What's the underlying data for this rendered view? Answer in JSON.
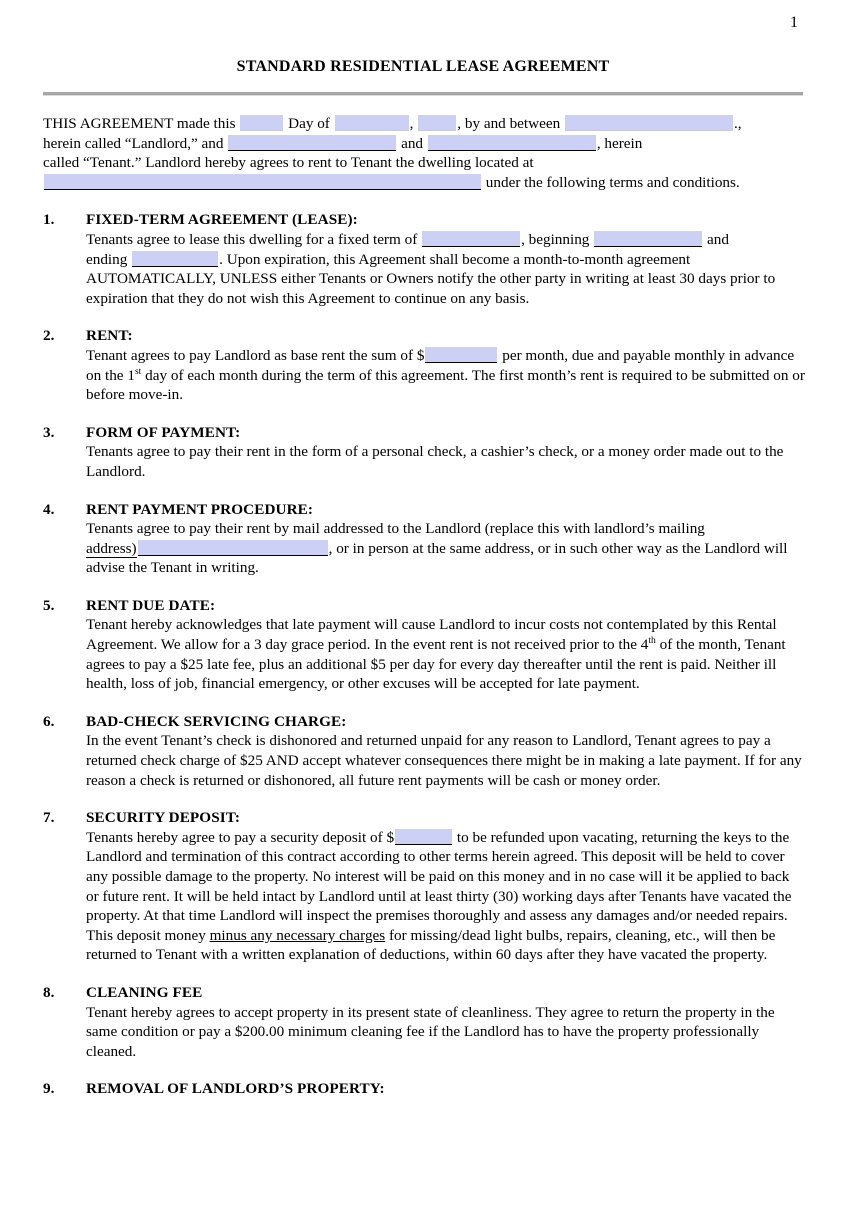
{
  "document": {
    "page_number": "1",
    "title": "STANDARD RESIDENTIAL LEASE AGREEMENT",
    "fill_field_color": "#ccd0f5",
    "rule_color": "#a6a6a6"
  },
  "intro": {
    "t1": "THIS AGREEMENT made this",
    "t2": "Day of",
    "t3": ",",
    "t4": ", by and between",
    "t5": ".,",
    "t6": "herein called “Landlord,” and",
    "t7": "and",
    "t8": ", herein",
    "t9": "called “Tenant.”  Landlord hereby agrees to rent to Tenant the dwelling located at",
    "t10": "under the following terms and conditions."
  },
  "sections": [
    {
      "number": "1.",
      "heading": "FIXED-TERM AGREEMENT (LEASE):",
      "parts": {
        "a": "Tenants agree to lease this dwelling for a fixed term of",
        "b": ", beginning",
        "c": "and",
        "d": "ending",
        "e": ".  Upon expiration, this Agreement shall become a month-to-month agreement AUTOMATICALLY, UNLESS either Tenants or Owners notify the other party in writing at least 30 days prior to expiration that they do not wish this Agreement to continue on any basis."
      }
    },
    {
      "number": "2.",
      "heading": "RENT:",
      "parts": {
        "a": "Tenant agrees to pay Landlord as base rent the sum of $",
        "b": "per month, due and payable monthly in advance on the 1",
        "sup": "st",
        "c": " day of each month during the term of this agreement.  The first month’s rent is required to be submitted on or before move-in."
      }
    },
    {
      "number": "3.",
      "heading": "FORM OF PAYMENT:",
      "parts": {
        "a": "Tenants agree to pay their rent in the form of a personal check, a cashier’s check, or a money order made out to the Landlord."
      }
    },
    {
      "number": "4.",
      "heading": "RENT PAYMENT PROCEDURE:",
      "parts": {
        "a": "Tenants agree to pay their rent by mail addressed to the Landlord (replace this with landlord’s mailing",
        "b": "address)",
        "c": ", or in person at the same address, or in such other way as the Landlord will advise the Tenant in writing."
      }
    },
    {
      "number": "5.",
      "heading": "RENT DUE DATE:",
      "parts": {
        "a": "Tenant hereby acknowledges that late payment will cause Landlord to incur costs not contemplated by this Rental Agreement.  We allow for a 3 day grace period.  In the event rent is not received prior to the 4",
        "sup": "th",
        "b": " of the month, Tenant agrees to pay a $25 late fee, plus an additional $5 per day for every day thereafter until the rent is paid.  Neither ill health, loss of job, financial emergency, or other excuses will be accepted for late payment."
      }
    },
    {
      "number": "6.",
      "heading": "BAD-CHECK SERVICING CHARGE:",
      "parts": {
        "a": "In the event Tenant’s check is dishonored and returned unpaid for any reason to Landlord, Tenant agrees to pay a returned check charge of $25 AND accept whatever consequences there might be in making a late payment.  If for any reason a check is returned or dishonored, all future rent payments will be cash or money order."
      }
    },
    {
      "number": "7.",
      "heading": "SECURITY DEPOSIT:",
      "parts": {
        "a": "Tenants hereby agree to pay a security deposit of $",
        "b": "to be refunded upon vacating, returning the keys to the Landlord and termination of this contract according to other terms herein agreed.  This deposit will be held to cover any possible damage to the property.  No interest will be paid on this money and in no case will it be applied to back or future rent.  It will be held intact by Landlord until at least thirty (30) working days after Tenants have vacated the property.  At that time Landlord will inspect the premises thoroughly and assess any damages and/or needed repairs.  This deposit money ",
        "c_underlined": "minus any necessary charges",
        "d": " for missing/dead light bulbs, repairs, cleaning, etc., will then be returned to Tenant with a written explanation of deductions, within 60 days after they have vacated the property."
      }
    },
    {
      "number": "8.",
      "heading": "CLEANING FEE",
      "parts": {
        "a": "Tenant hereby agrees to accept property in its present state of cleanliness.  They agree to return the property in the same condition or pay a $200.00 minimum cleaning fee if the Landlord has to have the property professionally cleaned."
      }
    },
    {
      "number": "9.",
      "heading": "REMOVAL OF LANDLORD’S PROPERTY:",
      "parts": {}
    }
  ]
}
